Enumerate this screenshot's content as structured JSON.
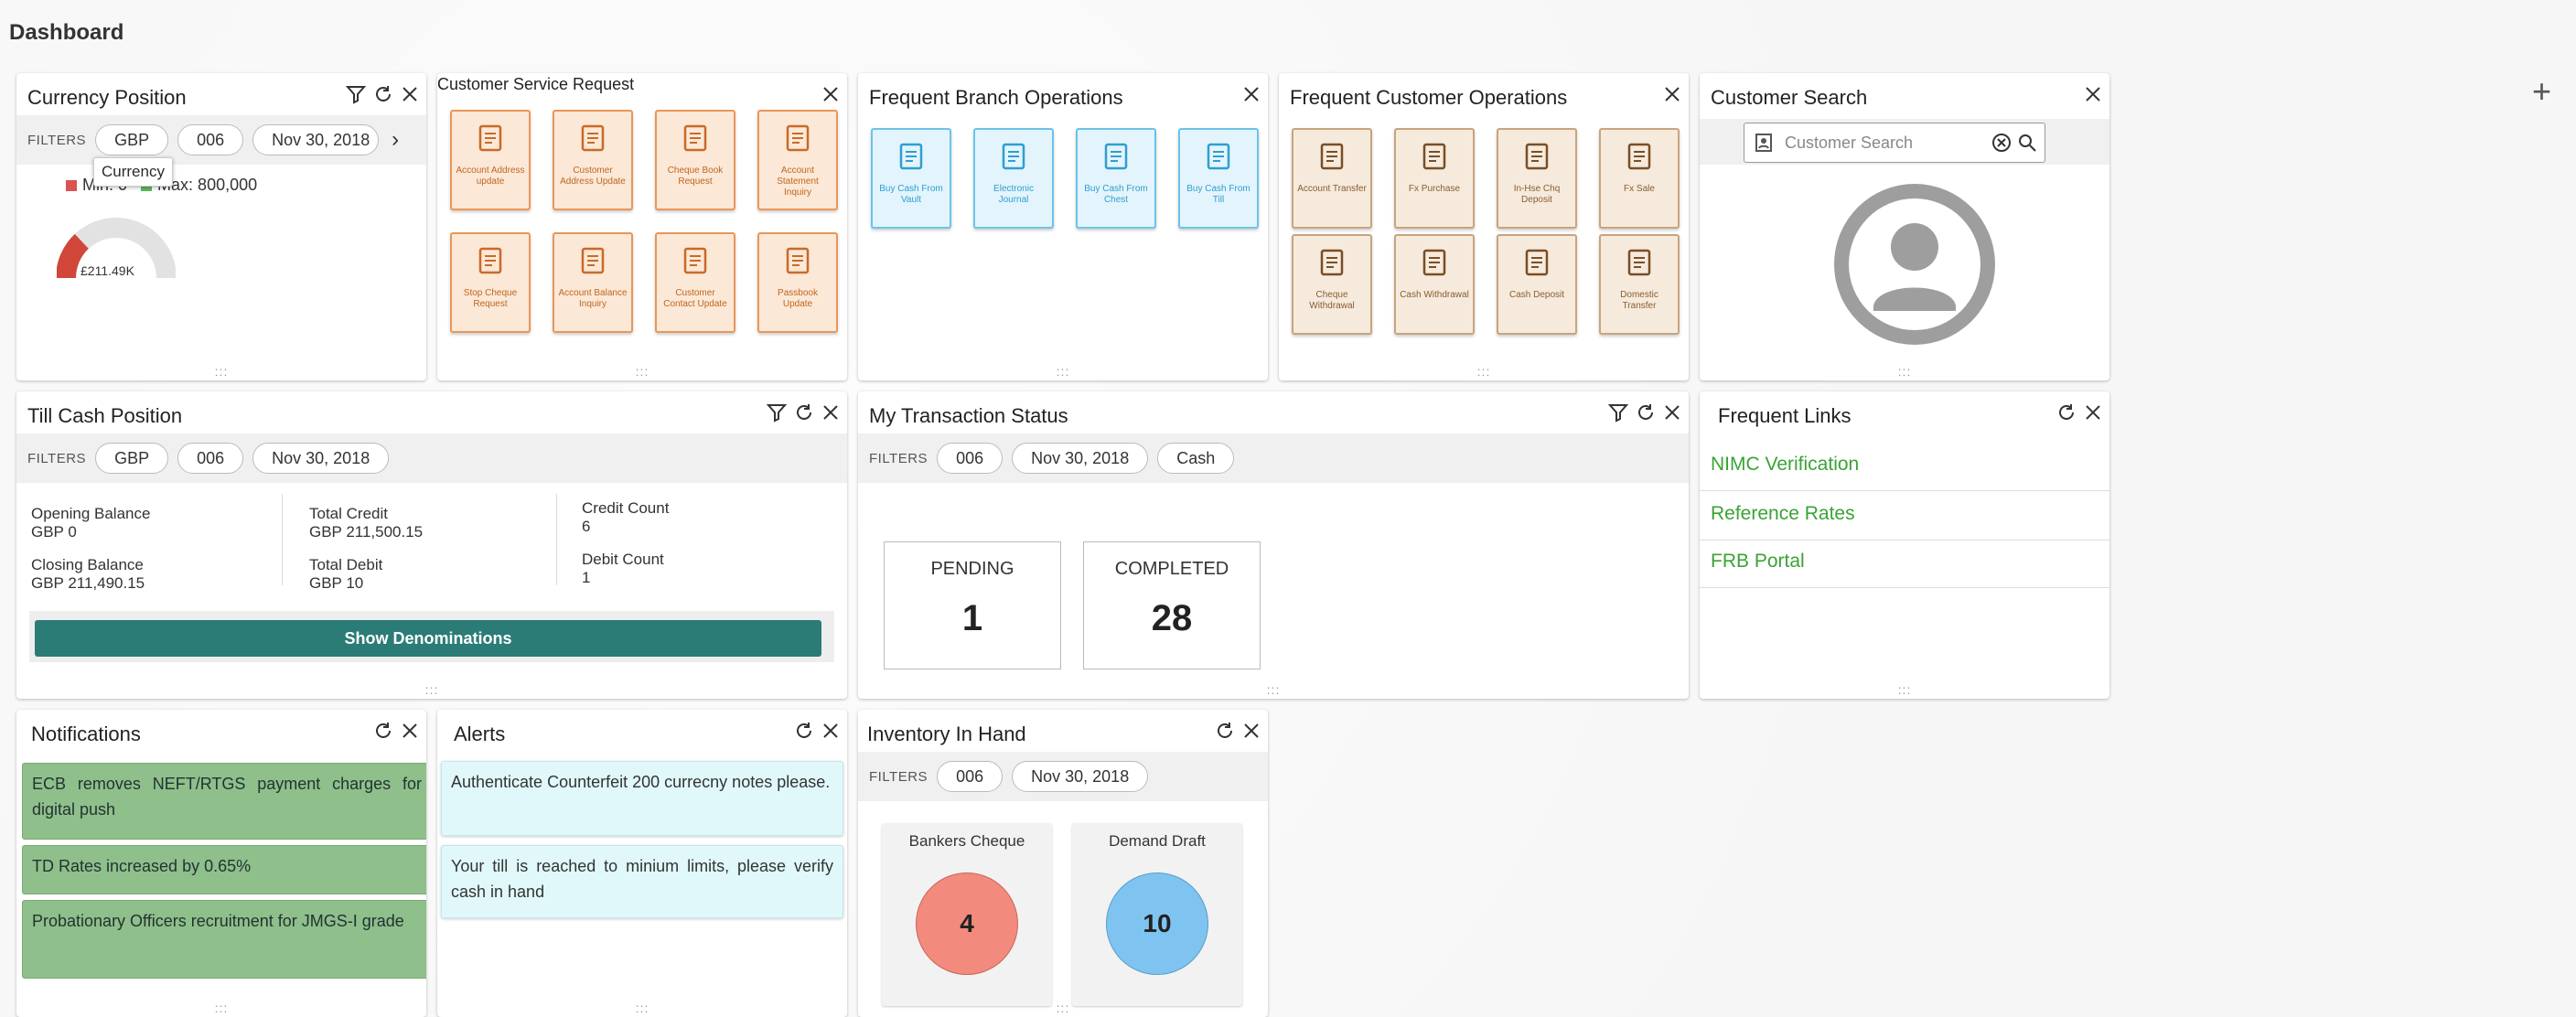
{
  "page_title": "Dashboard",
  "currency_widget": {
    "title": "Currency Position",
    "tooltip": "Currency",
    "filters_label": "FILTERS",
    "filters": [
      "GBP",
      "006",
      "Nov 30, 2018"
    ],
    "legend_min": "Min: 0",
    "legend_max": "Max: 800,000",
    "gauge_value_label": "£211.49K",
    "gauge_fraction": 0.26,
    "colors": {
      "min": "#d9534f",
      "max": "#5cb85c"
    }
  },
  "csr_widget": {
    "title": "Customer Service Request",
    "tiles": [
      "Account Address update",
      "Customer Address Update",
      "Cheque Book Request",
      "Account Statement Inquiry",
      "Stop Cheque Request",
      "Account Balance Inquiry",
      "Customer Contact Update",
      "Passbook Update"
    ],
    "icons": [
      "address-icon",
      "location-pin-icon",
      "cheque-book-icon",
      "statement-icon",
      "stop-cheque-icon",
      "balance-icon",
      "phone-icon",
      "passbook-icon"
    ]
  },
  "fbo_widget": {
    "title": "Frequent Branch Operations",
    "tiles": [
      "Buy Cash From Vault",
      "Electronic Journal",
      "Buy Cash From Chest",
      "Buy Cash From Till"
    ]
  },
  "fco_widget": {
    "title": "Frequent Customer Operations",
    "tiles": [
      "Account Transfer",
      "Fx Purchase",
      "In-Hse Chq Deposit",
      "Fx Sale",
      "Cheque Withdrawal",
      "Cash Withdrawal",
      "Cash Deposit",
      "Domestic Transfer"
    ]
  },
  "customer_search": {
    "title": "Customer Search",
    "placeholder": "Customer Search"
  },
  "till_cash": {
    "title": "Till Cash Position",
    "filters_label": "FILTERS",
    "filters": [
      "GBP",
      "006",
      "Nov 30, 2018"
    ],
    "opening_label": "Opening Balance",
    "opening_value": "GBP 0",
    "closing_label": "Closing Balance",
    "closing_value": "GBP 211,490.15",
    "credit_label": "Total Credit",
    "credit_value": "GBP 211,500.15",
    "debit_label": "Total Debit",
    "debit_value": "GBP 10",
    "credit_count_label": "Credit Count",
    "credit_count_value": "6",
    "debit_count_label": "Debit Count",
    "debit_count_value": "1",
    "button": "Show Denominations"
  },
  "txn_status": {
    "title": "My Transaction Status",
    "filters_label": "FILTERS",
    "filters": [
      "006",
      "Nov 30, 2018",
      "Cash"
    ],
    "pending_label": "PENDING",
    "pending_value": "1",
    "completed_label": "COMPLETED",
    "completed_value": "28"
  },
  "frequent_links": {
    "title": "Frequent Links",
    "links": [
      "NIMC Verification",
      "Reference Rates",
      "FRB Portal"
    ]
  },
  "notifications": {
    "title": "Notifications",
    "items": [
      "ECB removes NEFT/RTGS payment charges for digital push",
      "TD Rates increased by 0.65%",
      "Probationary Officers recruitment for JMGS-I grade"
    ]
  },
  "alerts": {
    "title": "Alerts",
    "items": [
      "Authenticate Counterfeit 200 currecny notes please.",
      "Your till is reached to minium limits, please verify cash in hand"
    ]
  },
  "inventory": {
    "title": "Inventory In Hand",
    "filters_label": "FILTERS",
    "filters": [
      "006",
      "Nov 30, 2018"
    ],
    "items": [
      {
        "label": "Bankers Cheque",
        "value": "4",
        "color": "#f28b7d"
      },
      {
        "label": "Demand Draft",
        "value": "10",
        "color": "#7fc4f0"
      }
    ]
  }
}
